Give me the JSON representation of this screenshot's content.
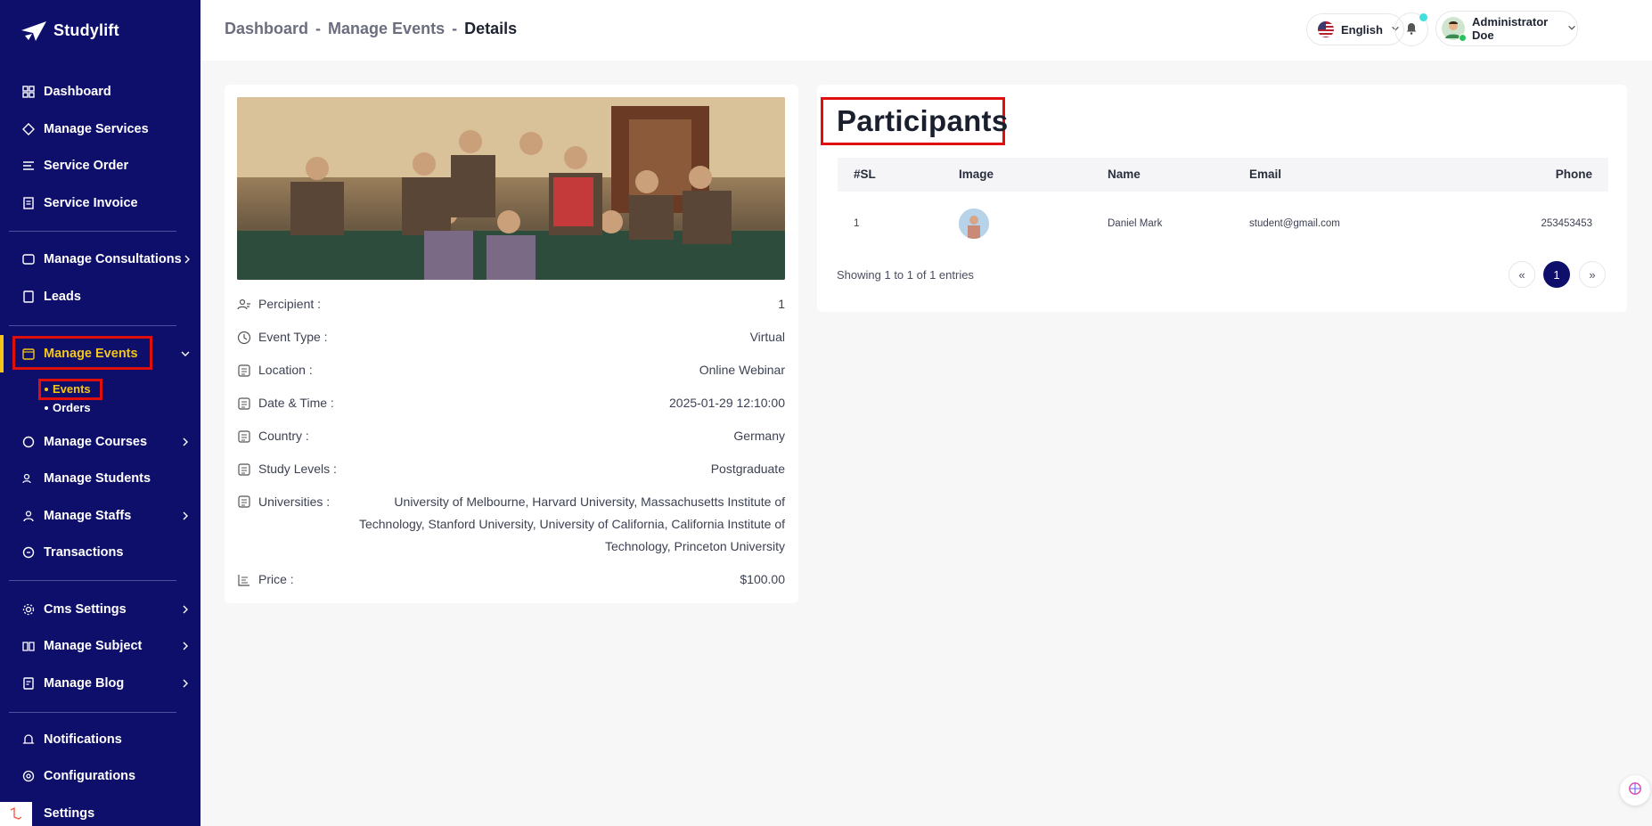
{
  "brand": {
    "name": "Studylift"
  },
  "sidebar": {
    "items": [
      {
        "label": "Dashboard",
        "icon": "dashboard-icon"
      },
      {
        "label": "Manage Services",
        "icon": "services-icon"
      },
      {
        "label": "Service Order",
        "icon": "list-icon"
      },
      {
        "label": "Service Invoice",
        "icon": "invoice-icon"
      },
      {
        "label": "Manage Consultations",
        "icon": "consultation-icon"
      },
      {
        "label": "Leads",
        "icon": "leads-icon"
      },
      {
        "label": "Manage Events",
        "icon": "calendar-icon"
      },
      {
        "label": "Manage Courses",
        "icon": "courses-icon"
      },
      {
        "label": "Manage Students",
        "icon": "students-icon"
      },
      {
        "label": "Manage Staffs",
        "icon": "staff-icon"
      },
      {
        "label": "Transactions",
        "icon": "transactions-icon"
      },
      {
        "label": "Cms Settings",
        "icon": "cms-icon"
      },
      {
        "label": "Manage Subject",
        "icon": "subject-icon"
      },
      {
        "label": "Manage Blog",
        "icon": "blog-icon"
      },
      {
        "label": "Notifications",
        "icon": "bell-icon"
      },
      {
        "label": "Configurations",
        "icon": "config-icon"
      },
      {
        "label": "Settings",
        "icon": "settings-icon"
      }
    ],
    "sub_items": [
      {
        "label": "Events"
      },
      {
        "label": "Orders"
      }
    ]
  },
  "header": {
    "breadcrumb": [
      "Dashboard",
      "Manage Events",
      "Details"
    ],
    "breadcrumb_sep": "-",
    "language": "English",
    "user_name": "Administrator Doe"
  },
  "event": {
    "details": [
      {
        "label": "Percipient :",
        "value": "1",
        "icon": "participants-icon"
      },
      {
        "label": "Event Type :",
        "value": "Virtual",
        "icon": "clock-icon"
      },
      {
        "label": "Location :",
        "value": "Online Webinar",
        "icon": "document-icon"
      },
      {
        "label": "Date & Time :",
        "value": "2025-01-29 12:10:00",
        "icon": "document-icon"
      },
      {
        "label": "Country :",
        "value": "Germany",
        "icon": "document-icon"
      },
      {
        "label": "Study Levels :",
        "value": "Postgraduate",
        "icon": "document-icon"
      },
      {
        "label": "Universities :",
        "value": "University of Melbourne, Harvard University, Massachusetts Institute of Technology, Stanford University, University of California, California Institute of Technology, Princeton University",
        "icon": "document-icon"
      },
      {
        "label": "Price :",
        "value": "$100.00",
        "icon": "price-icon"
      }
    ]
  },
  "participants": {
    "title": "Participants",
    "columns": [
      "#SL",
      "Image",
      "Name",
      "Email",
      "Phone"
    ],
    "rows": [
      {
        "sl": "1",
        "name": "Daniel Mark",
        "email": "student@gmail.com",
        "phone": "253453453"
      }
    ],
    "showing": "Showing 1 to 1 of 1 entries",
    "pagination": {
      "prev": "«",
      "current": "1",
      "next": "»"
    }
  },
  "colors": {
    "sidebar_bg": "#0e0f6b",
    "active_accent": "#f5c518",
    "highlight_box": "#e10e0e",
    "page_bg": "#f7f7f8"
  }
}
